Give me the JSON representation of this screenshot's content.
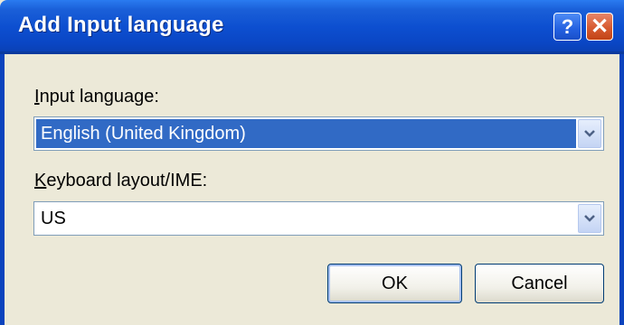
{
  "window": {
    "title": "Add Input language",
    "help_button_label": "?",
    "close_button_label": "✕"
  },
  "input_language": {
    "label": "Input language:",
    "value": "English (United Kingdom)",
    "focused": true
  },
  "keyboard_layout": {
    "label": "Keyboard layout/IME:",
    "value": "US"
  },
  "buttons": {
    "ok_label": "OK",
    "cancel_label": "Cancel"
  },
  "colors": {
    "titlebar": "#0d4fd0",
    "selection": "#316ac5",
    "dialog_bg": "#ece9d8",
    "close_button": "#d75a30"
  }
}
